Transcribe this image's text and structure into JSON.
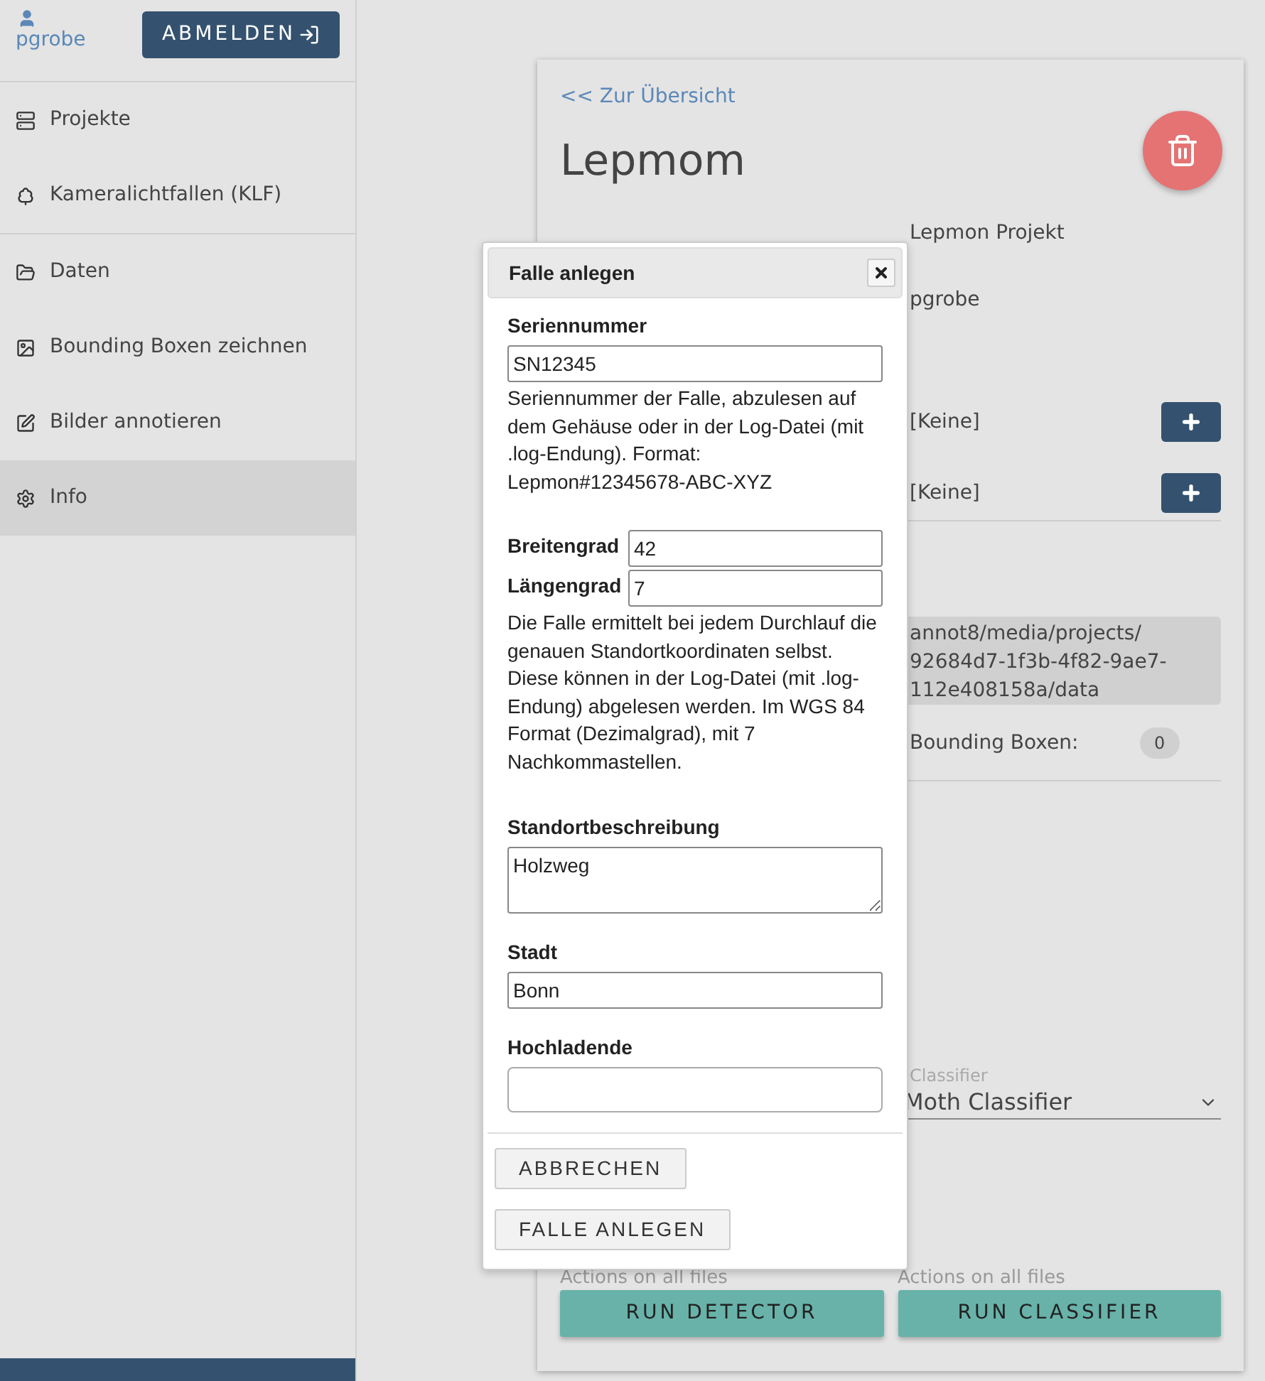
{
  "user": {
    "name": "pgrobe"
  },
  "logout_button": "ABMELDEN",
  "sidebar": {
    "groups": [
      [
        {
          "label": "Projekte",
          "selected": false
        },
        {
          "label": "Kameralichtfallen (KLF)",
          "selected": false
        }
      ],
      [
        {
          "label": "Daten",
          "selected": false
        },
        {
          "label": "Bounding Boxen zeichnen",
          "selected": false
        },
        {
          "label": "Bilder annotieren",
          "selected": false
        },
        {
          "label": "Info",
          "selected": true
        }
      ]
    ]
  },
  "project": {
    "back_link": "<< Zur Übersicht",
    "title": "Lepmom",
    "description": "Lepmon Projekt",
    "owner": "pgrobe",
    "assignments": [
      "[Keine]",
      "[Keine]"
    ],
    "path_lines": [
      "annot8/media/projects/",
      "92684d7-1f3b-4f82-9ae7-",
      "112e408158a/data"
    ],
    "bbox_label": "Bounding Boxen:",
    "bbox_count": "0",
    "classifier_label": "Classifier",
    "classifier_value": "Moth Classifier",
    "actions": [
      {
        "hint": "Actions on all files",
        "button": "RUN DETECTOR"
      },
      {
        "hint": "Actions on all files",
        "button": "RUN CLASSIFIER"
      }
    ]
  },
  "dialog": {
    "title": "Falle anlegen",
    "serial": {
      "label": "Seriennummer",
      "value": "SN12345",
      "help": "Seriennummer der Falle, abzulesen auf dem Gehäuse oder in der Log-Datei (mit .log-Endung). Format: Lepmon#12345678-ABC-XYZ"
    },
    "coords": [
      {
        "label": "Breitengrad",
        "value": "42"
      },
      {
        "label": "Längengrad",
        "value": "7"
      }
    ],
    "coords_help": "Die Falle ermittelt bei jedem Durchlauf die genauen Standortkoordinaten selbst. Diese können in der Log-Datei (mit .log-Endung) abgelesen werden. Im WGS 84 Format (Dezimalgrad), mit 7 Nachkommastellen.",
    "location": {
      "label": "Standortbeschreibung",
      "value": "Holzweg"
    },
    "city": {
      "label": "Stadt",
      "value": "Bonn"
    },
    "uploader": {
      "label": "Hochladende"
    },
    "buttons": [
      "ABBRECHEN",
      "FALLE ANLEGEN"
    ]
  }
}
